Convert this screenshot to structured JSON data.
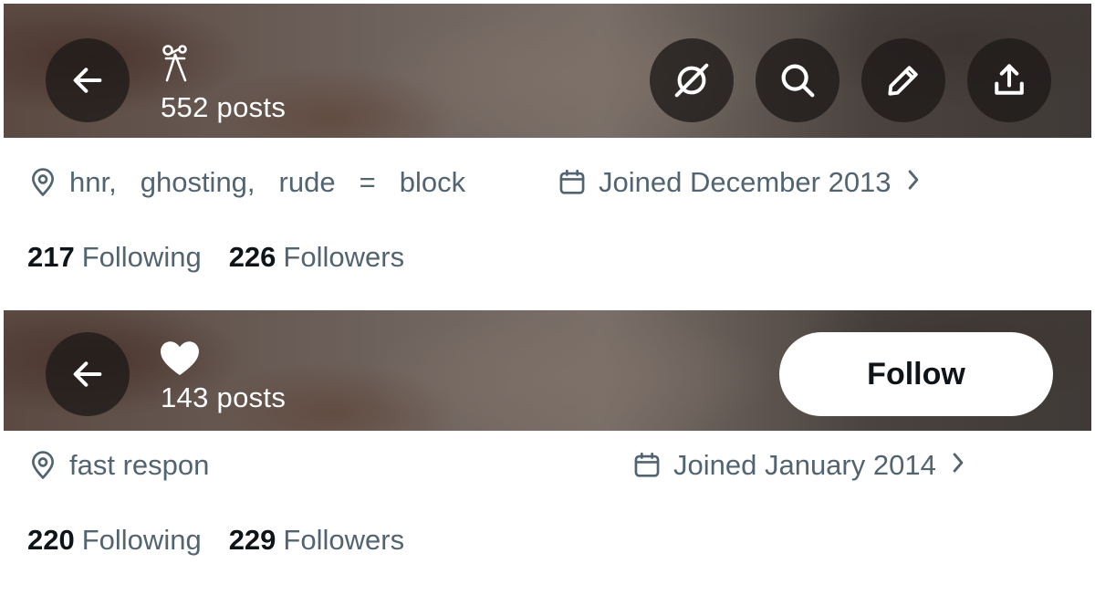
{
  "profiles": [
    {
      "name_icon": "tool-emoji-icon",
      "post_count": "552 posts",
      "header_actions": [
        "grok-icon",
        "search-icon",
        "edit-icon",
        "share-icon"
      ],
      "location": [
        "hnr,",
        "ghosting,",
        "rude",
        "=",
        "block"
      ],
      "joined": "Joined December 2013",
      "following_count": "217",
      "following_label": "Following",
      "followers_count": "226",
      "followers_label": "Followers"
    },
    {
      "name_icon": "heart-emoji-icon",
      "post_count": "143 posts",
      "follow_label": "Follow",
      "location": "fast respon",
      "joined": "Joined January 2014",
      "following_count": "220",
      "following_label": "Following",
      "followers_count": "229",
      "followers_label": "Followers"
    }
  ],
  "colors": {
    "primary_text": "#0f1419",
    "secondary_text": "#536471",
    "button_bg": "#ffffff",
    "icon_circle_bg": "rgba(30,26,24,0.78)"
  }
}
